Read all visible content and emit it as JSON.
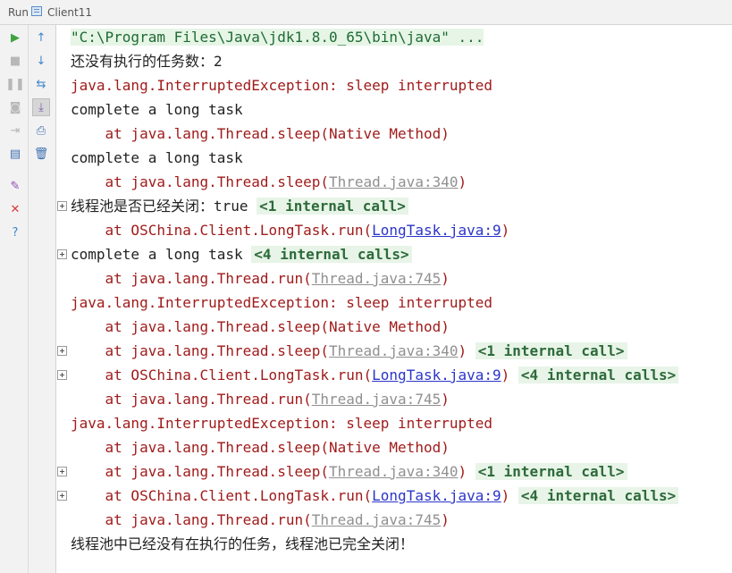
{
  "titlebar": {
    "run_label": "Run",
    "tab_label": "Client11"
  },
  "toolbar": {
    "buttons": [
      {
        "icon": "run-icon",
        "glyph": "▶",
        "color": "#3fa33f"
      },
      {
        "icon": "stop-icon",
        "glyph": "■",
        "color": "#b8b8b8"
      },
      {
        "icon": "pause-icon",
        "glyph": "❚❚",
        "color": "#b8b8b8"
      },
      {
        "icon": "camera-icon",
        "glyph": "◙",
        "color": "#b8b8b8"
      },
      {
        "icon": "exit-icon",
        "glyph": "⇥",
        "color": "#b8b8b8"
      },
      {
        "icon": "layout-icon",
        "glyph": "▤",
        "color": "#3e6fb0"
      },
      {
        "icon": "pin-icon",
        "glyph": "✎",
        "color": "#8b4bb8"
      },
      {
        "icon": "close-icon",
        "glyph": "✕",
        "color": "#d93a3a"
      },
      {
        "icon": "help-icon",
        "glyph": "?",
        "color": "#3e86c9"
      },
      {
        "icon": "up-arrow-icon",
        "glyph": "↑",
        "color": "#3e86c9"
      },
      {
        "icon": "down-arrow-icon",
        "glyph": "↓",
        "color": "#3e86c9"
      },
      {
        "icon": "wrap-icon",
        "glyph": "⇆",
        "color": "#3e86c9"
      },
      {
        "icon": "scroll-to-end-icon",
        "glyph": "⤓",
        "color": "#7a5bb0"
      },
      {
        "icon": "print-icon",
        "glyph": "⎙",
        "color": "#3e6fb0"
      },
      {
        "icon": "trash-icon",
        "glyph": "🗑",
        "color": "#3e6fb0"
      }
    ]
  },
  "console": {
    "lines": [
      {
        "segments": [
          {
            "text": "\"C:\\Program Files\\Java\\jdk1.8.0_65\\bin\\java\" ...",
            "cls": "cmd"
          }
        ]
      },
      {
        "segments": [
          {
            "text": "还没有执行的任务数：2",
            "cls": "out"
          }
        ]
      },
      {
        "segments": [
          {
            "text": "java.lang.InterruptedException: sleep interrupted",
            "cls": "err"
          }
        ]
      },
      {
        "segments": [
          {
            "text": "complete a long task",
            "cls": "out"
          }
        ]
      },
      {
        "segments": [
          {
            "text": "    at java.lang.Thread.sleep(Native Method)",
            "cls": "trace"
          }
        ]
      },
      {
        "segments": [
          {
            "text": "complete a long task",
            "cls": "out"
          }
        ]
      },
      {
        "segments": [
          {
            "text": "    at java.lang.Thread.sleep(",
            "cls": "trace"
          },
          {
            "text": "Thread.java:340",
            "cls": "graylink"
          },
          {
            "text": ")",
            "cls": "trace"
          }
        ]
      },
      {
        "expand": true,
        "segments": [
          {
            "text": "线程池是否已经关闭：true ",
            "cls": "out"
          },
          {
            "text": "<1 internal call>",
            "cls": "fold"
          }
        ]
      },
      {
        "segments": [
          {
            "text": "    at OSChina.Client.LongTask.run(",
            "cls": "trace"
          },
          {
            "text": "LongTask.java:9",
            "cls": "link"
          },
          {
            "text": ")",
            "cls": "trace"
          }
        ]
      },
      {
        "expand": true,
        "segments": [
          {
            "text": "complete a long task ",
            "cls": "out"
          },
          {
            "text": "<4 internal calls>",
            "cls": "fold"
          }
        ]
      },
      {
        "segments": [
          {
            "text": "    at java.lang.Thread.run(",
            "cls": "trace"
          },
          {
            "text": "Thread.java:745",
            "cls": "graylink"
          },
          {
            "text": ")",
            "cls": "trace"
          }
        ]
      },
      {
        "segments": [
          {
            "text": "java.lang.InterruptedException: sleep interrupted",
            "cls": "err"
          }
        ]
      },
      {
        "segments": [
          {
            "text": "    at java.lang.Thread.sleep(Native Method)",
            "cls": "trace"
          }
        ]
      },
      {
        "expand": true,
        "segments": [
          {
            "text": "    at java.lang.Thread.sleep(",
            "cls": "trace"
          },
          {
            "text": "Thread.java:340",
            "cls": "graylink"
          },
          {
            "text": ") ",
            "cls": "trace"
          },
          {
            "text": "<1 internal call>",
            "cls": "fold"
          }
        ]
      },
      {
        "expand": true,
        "segments": [
          {
            "text": "    at OSChina.Client.LongTask.run(",
            "cls": "trace"
          },
          {
            "text": "LongTask.java:9",
            "cls": "link"
          },
          {
            "text": ") ",
            "cls": "trace"
          },
          {
            "text": "<4 internal calls>",
            "cls": "fold"
          }
        ]
      },
      {
        "segments": [
          {
            "text": "    at java.lang.Thread.run(",
            "cls": "trace"
          },
          {
            "text": "Thread.java:745",
            "cls": "graylink"
          },
          {
            "text": ")",
            "cls": "trace"
          }
        ]
      },
      {
        "segments": [
          {
            "text": "java.lang.InterruptedException: sleep interrupted",
            "cls": "err"
          }
        ]
      },
      {
        "segments": [
          {
            "text": "    at java.lang.Thread.sleep(Native Method)",
            "cls": "trace"
          }
        ]
      },
      {
        "expand": true,
        "segments": [
          {
            "text": "    at java.lang.Thread.sleep(",
            "cls": "trace"
          },
          {
            "text": "Thread.java:340",
            "cls": "graylink"
          },
          {
            "text": ") ",
            "cls": "trace"
          },
          {
            "text": "<1 internal call>",
            "cls": "fold"
          }
        ]
      },
      {
        "expand": true,
        "segments": [
          {
            "text": "    at OSChina.Client.LongTask.run(",
            "cls": "trace"
          },
          {
            "text": "LongTask.java:9",
            "cls": "link"
          },
          {
            "text": ") ",
            "cls": "trace"
          },
          {
            "text": "<4 internal calls>",
            "cls": "fold"
          }
        ]
      },
      {
        "segments": [
          {
            "text": "    at java.lang.Thread.run(",
            "cls": "trace"
          },
          {
            "text": "Thread.java:745",
            "cls": "graylink"
          },
          {
            "text": ")",
            "cls": "trace"
          }
        ]
      },
      {
        "segments": [
          {
            "text": "线程池中已经没有在执行的任务，线程池已完全关闭！",
            "cls": "out"
          }
        ]
      }
    ]
  }
}
